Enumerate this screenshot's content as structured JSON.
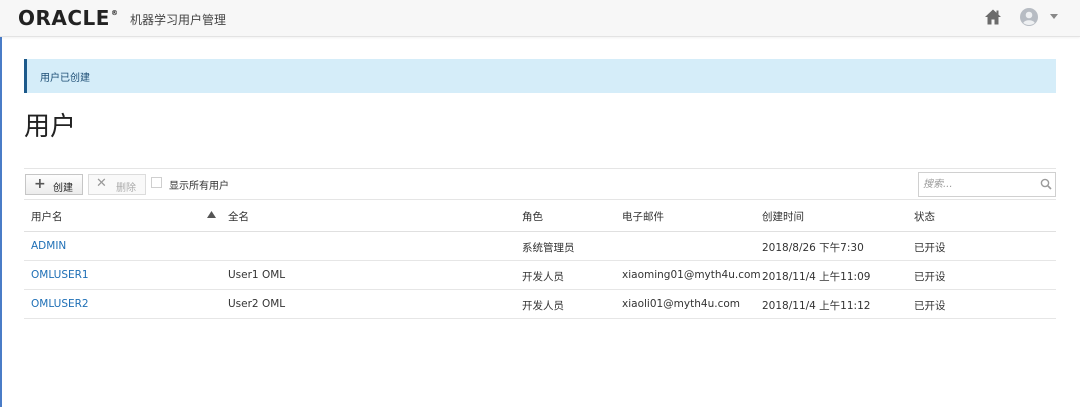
{
  "header": {
    "logo": "ORACLE",
    "logo_mark": "®",
    "app_name": "机器学习用户管理",
    "icons": {
      "home": "home-icon",
      "user": "user-avatar-icon",
      "menu": "caret-down-icon"
    }
  },
  "notification": {
    "text": "用户已创建"
  },
  "page": {
    "title": "用户"
  },
  "toolbar": {
    "create_label": "创建",
    "create_icon": "plus-icon",
    "delete_label": "删除",
    "delete_icon": "x-icon",
    "show_all_label": "显示所有用户",
    "show_all_checked": false,
    "search_placeholder": "搜索..."
  },
  "table": {
    "columns": [
      "用户名",
      "全名",
      "角色",
      "电子邮件",
      "创建时间",
      "状态"
    ],
    "sort": {
      "column": "全名",
      "direction": "ascending"
    },
    "rows": [
      {
        "username": "ADMIN",
        "fullname": "",
        "role": "系统管理员",
        "email": "",
        "created": "2018/8/26 下午7:30",
        "status": "已开设"
      },
      {
        "username": "OMLUSER1",
        "fullname": "User1 OML",
        "role": "开发人员",
        "email": "xiaoming01@myth4u.com",
        "created": "2018/11/4 上午11:09",
        "status": "已开设"
      },
      {
        "username": "OMLUSER2",
        "fullname": "User2 OML",
        "role": "开发人员",
        "email": "xiaoli01@myth4u.com",
        "created": "2018/11/4 上午11:12",
        "status": "已开设"
      }
    ]
  },
  "colors": {
    "link": "#1e6fb6",
    "banner_bg": "#d5edf9",
    "banner_border": "#1d5a8b",
    "header_bg": "#f7f7f7"
  }
}
